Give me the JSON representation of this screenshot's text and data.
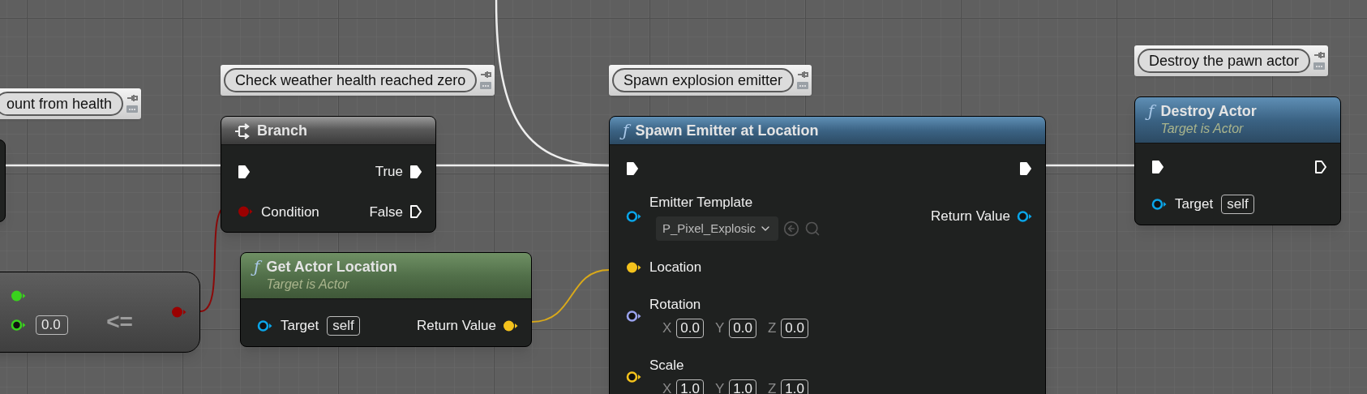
{
  "nodes": [
    {
      "kind": "partial",
      "comment": "ount from health"
    },
    {
      "kind": "flow",
      "title": "Branch",
      "comment": "Check weather health reached zero",
      "inputs": [
        {
          "kind": "exec",
          "connected": true
        },
        {
          "kind": "bool",
          "label": "Condition",
          "connected": true
        }
      ],
      "outputs": [
        {
          "kind": "exec",
          "label": "True",
          "connected": true
        },
        {
          "kind": "exec",
          "label": "False",
          "connected": false
        }
      ]
    },
    {
      "kind": "operator",
      "symbol": "<=",
      "inputs": [
        {
          "kind": "float",
          "connected": true
        },
        {
          "kind": "float",
          "connected": false,
          "value": "0.0"
        }
      ],
      "outputs": [
        {
          "kind": "bool",
          "connected": true
        }
      ]
    },
    {
      "kind": "pure",
      "icon": "ƒ",
      "title": "Get Actor Location",
      "subtitle": "Target is Actor",
      "inputs": [
        {
          "kind": "object",
          "label": "Target",
          "connected": false,
          "value": "self"
        }
      ],
      "outputs": [
        {
          "kind": "vector",
          "label": "Return Value",
          "connected": true
        }
      ]
    },
    {
      "kind": "function",
      "icon": "ƒ",
      "title": "Spawn Emitter at Location",
      "comment": "Spawn explosion emitter",
      "inputs": [
        {
          "kind": "exec",
          "connected": true
        },
        {
          "kind": "object",
          "label": "Emitter Template",
          "connected": false,
          "asset": "P_Pixel_Explosic"
        },
        {
          "kind": "vector",
          "label": "Location",
          "connected": true
        },
        {
          "kind": "rotator",
          "label": "Rotation",
          "connected": false,
          "axes": [
            {
              "axis": "X",
              "value": "0.0"
            },
            {
              "axis": "Y",
              "value": "0.0"
            },
            {
              "axis": "Z",
              "value": "0.0"
            }
          ]
        },
        {
          "kind": "vector",
          "label": "Scale",
          "connected": false,
          "axes": [
            {
              "axis": "X",
              "value": "1.0"
            },
            {
              "axis": "Y",
              "value": "1.0"
            },
            {
              "axis": "Z",
              "value": "1.0"
            }
          ]
        }
      ],
      "outputs": [
        {
          "kind": "exec",
          "connected": true
        },
        {
          "kind": "object",
          "label": "Return Value",
          "connected": false
        }
      ]
    },
    {
      "kind": "function",
      "icon": "ƒ",
      "title": "Destroy Actor",
      "subtitle": "Target is Actor",
      "comment": "Destroy the pawn actor",
      "inputs": [
        {
          "kind": "exec",
          "connected": true
        },
        {
          "kind": "object",
          "label": "Target",
          "connected": false,
          "value": "self"
        }
      ],
      "outputs": [
        {
          "kind": "exec",
          "connected": false
        }
      ]
    }
  ]
}
